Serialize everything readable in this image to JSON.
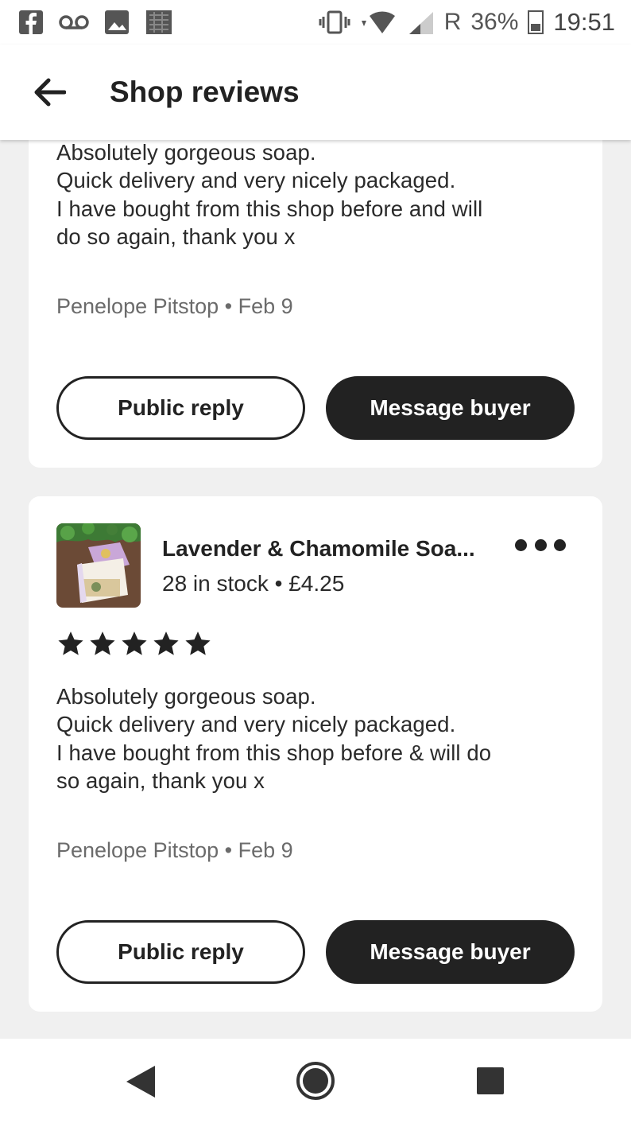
{
  "status_bar": {
    "left_icons": [
      "facebook-icon",
      "voicemail-icon",
      "gallery-icon",
      "app-notification-icon"
    ],
    "network_label": "R",
    "battery_percent": "36%",
    "time": "19:51"
  },
  "header": {
    "back_icon": "arrow-left-icon",
    "title": "Shop reviews"
  },
  "reviews": [
    {
      "text_lines": [
        "Absolutely gorgeous soap.",
        "Quick delivery and very nicely packaged.",
        "I have bought from this shop before and will",
        "do so again, thank you x"
      ],
      "reviewer": "Penelope Pitstop",
      "date": "Feb 9",
      "meta": "Penelope Pitstop • Feb 9",
      "public_reply_label": "Public reply",
      "message_buyer_label": "Message buyer"
    },
    {
      "product": {
        "title": "Lavender & Chamomile Soa...",
        "stock": "28 in stock",
        "price": "£4.25",
        "subtitle": "28 in stock • £4.25"
      },
      "rating": 5,
      "text_lines": [
        "Absolutely gorgeous soap.",
        "Quick delivery and very nicely packaged.",
        "I have bought from this shop before & will do",
        "so again, thank you x"
      ],
      "reviewer": "Penelope Pitstop",
      "date": "Feb 9",
      "meta": "Penelope Pitstop • Feb 9",
      "public_reply_label": "Public reply",
      "message_buyer_label": "Message buyer"
    }
  ],
  "nav_bar": {
    "icons": [
      "nav-back-icon",
      "nav-home-icon",
      "nav-recents-icon"
    ]
  },
  "colors": {
    "primary_dark": "#222222",
    "background": "#f0f0f0",
    "card": "#ffffff",
    "meta_text": "#6b6b6b"
  }
}
